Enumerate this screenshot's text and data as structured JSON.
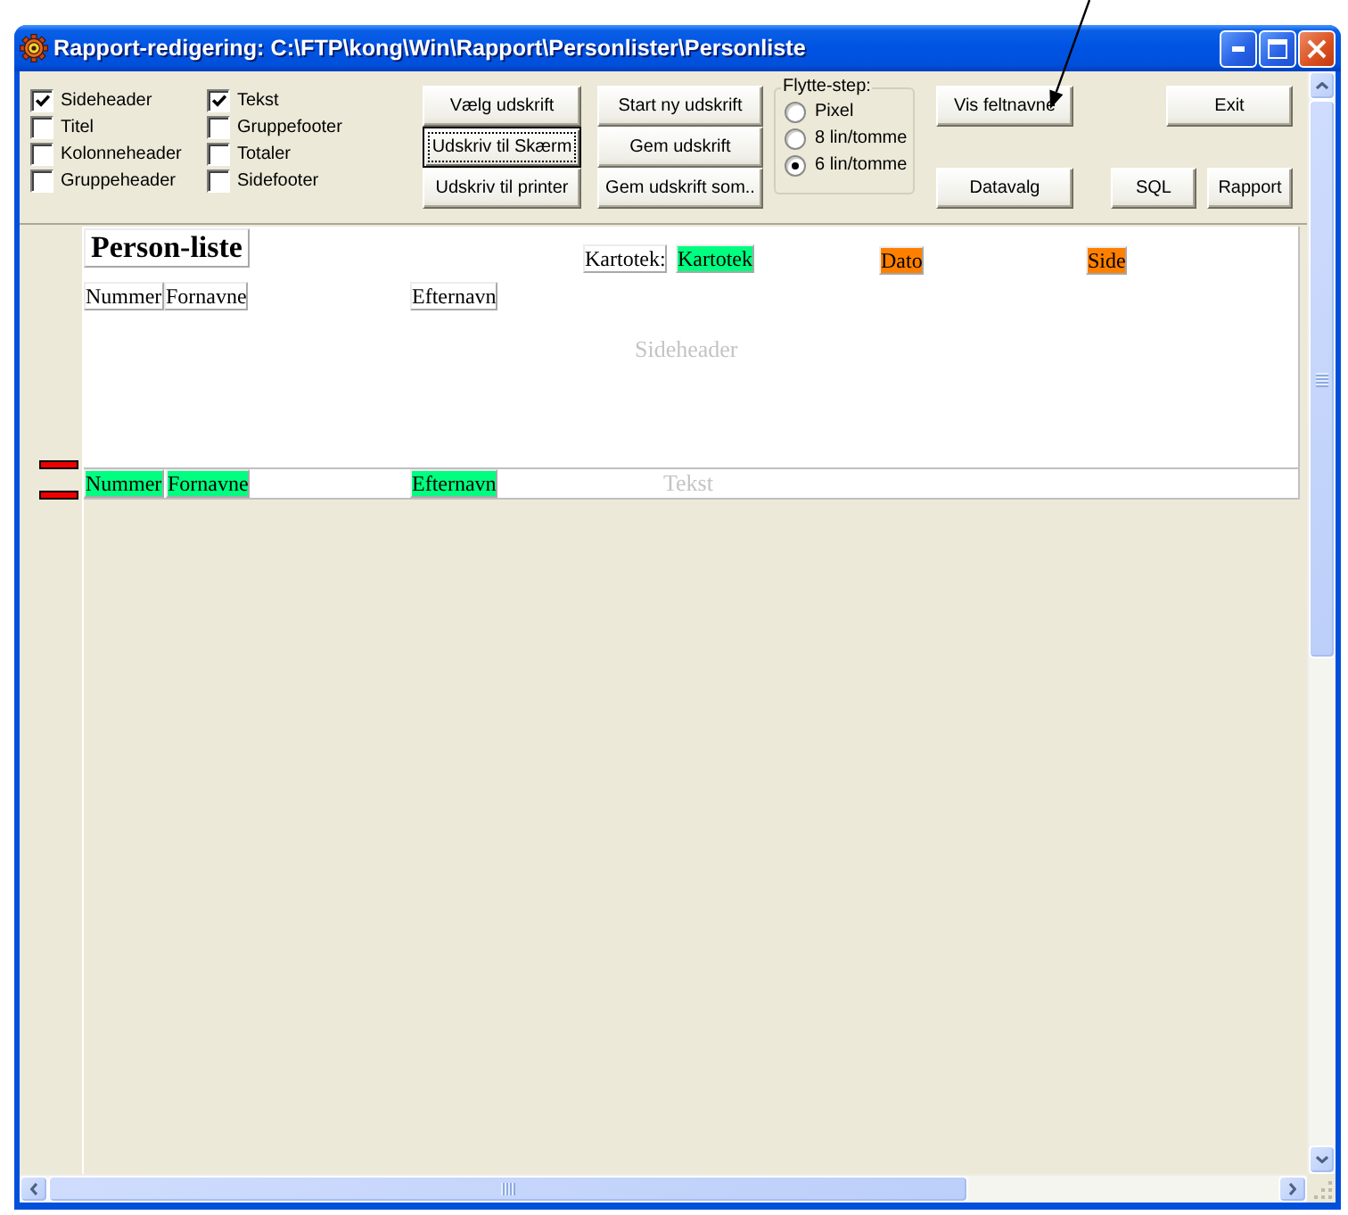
{
  "window": {
    "title": "Rapport-redigering: C:\\FTP\\kong\\Win\\Rapport\\Personlister\\Personliste"
  },
  "section_checkboxes": [
    {
      "label": "Sideheader",
      "checked": true
    },
    {
      "label": "Titel",
      "checked": false
    },
    {
      "label": "Kolonneheader",
      "checked": false
    },
    {
      "label": "Gruppeheader",
      "checked": false
    },
    {
      "label": "Tekst",
      "checked": true
    },
    {
      "label": "Gruppefooter",
      "checked": false
    },
    {
      "label": "Totaler",
      "checked": false
    },
    {
      "label": "Sidefooter",
      "checked": false
    }
  ],
  "output_buttons": [
    {
      "label": "Vælg udskrift",
      "focused": false
    },
    {
      "label": "Udskriv til Skærm",
      "focused": true
    },
    {
      "label": "Udskriv til printer",
      "focused": false
    }
  ],
  "file_buttons": [
    {
      "label": "Start ny udskrift"
    },
    {
      "label": "Gem udskrift"
    },
    {
      "label": "Gem udskrift som.."
    }
  ],
  "move_step": {
    "title": "Flytte-step:",
    "options": [
      {
        "label": "Pixel",
        "selected": false
      },
      {
        "label": "8 lin/tomme",
        "selected": false
      },
      {
        "label": "6 lin/tomme",
        "selected": true
      }
    ]
  },
  "field_buttons": [
    {
      "label": "Vis feltnavne"
    },
    {
      "label": "Datavalg"
    }
  ],
  "exit_button": {
    "label": "Exit"
  },
  "query_buttons": [
    {
      "label": "SQL"
    },
    {
      "label": "Rapport"
    }
  ],
  "report": {
    "bands": [
      {
        "label": "Sideheader",
        "fields": [
          {
            "kind": "title",
            "text": "Person-liste"
          },
          {
            "kind": "label",
            "text": "Kartotek:"
          },
          {
            "kind": "field",
            "text": "Kartotek",
            "color": "#00ff80"
          },
          {
            "kind": "field",
            "text": "Dato",
            "color": "#ff8000"
          },
          {
            "kind": "field",
            "text": "Side",
            "color": "#ff8000"
          },
          {
            "kind": "label",
            "text": "Nummer"
          },
          {
            "kind": "label",
            "text": "Fornavne"
          },
          {
            "kind": "label",
            "text": "Efternavn"
          }
        ]
      },
      {
        "label": "Tekst",
        "fields": [
          {
            "kind": "field",
            "text": "Nummer",
            "color": "#00ff80"
          },
          {
            "kind": "field",
            "text": "Fornavne",
            "color": "#00ff80"
          },
          {
            "kind": "field",
            "text": "Efternavn",
            "color": "#00ff80"
          }
        ]
      }
    ]
  }
}
